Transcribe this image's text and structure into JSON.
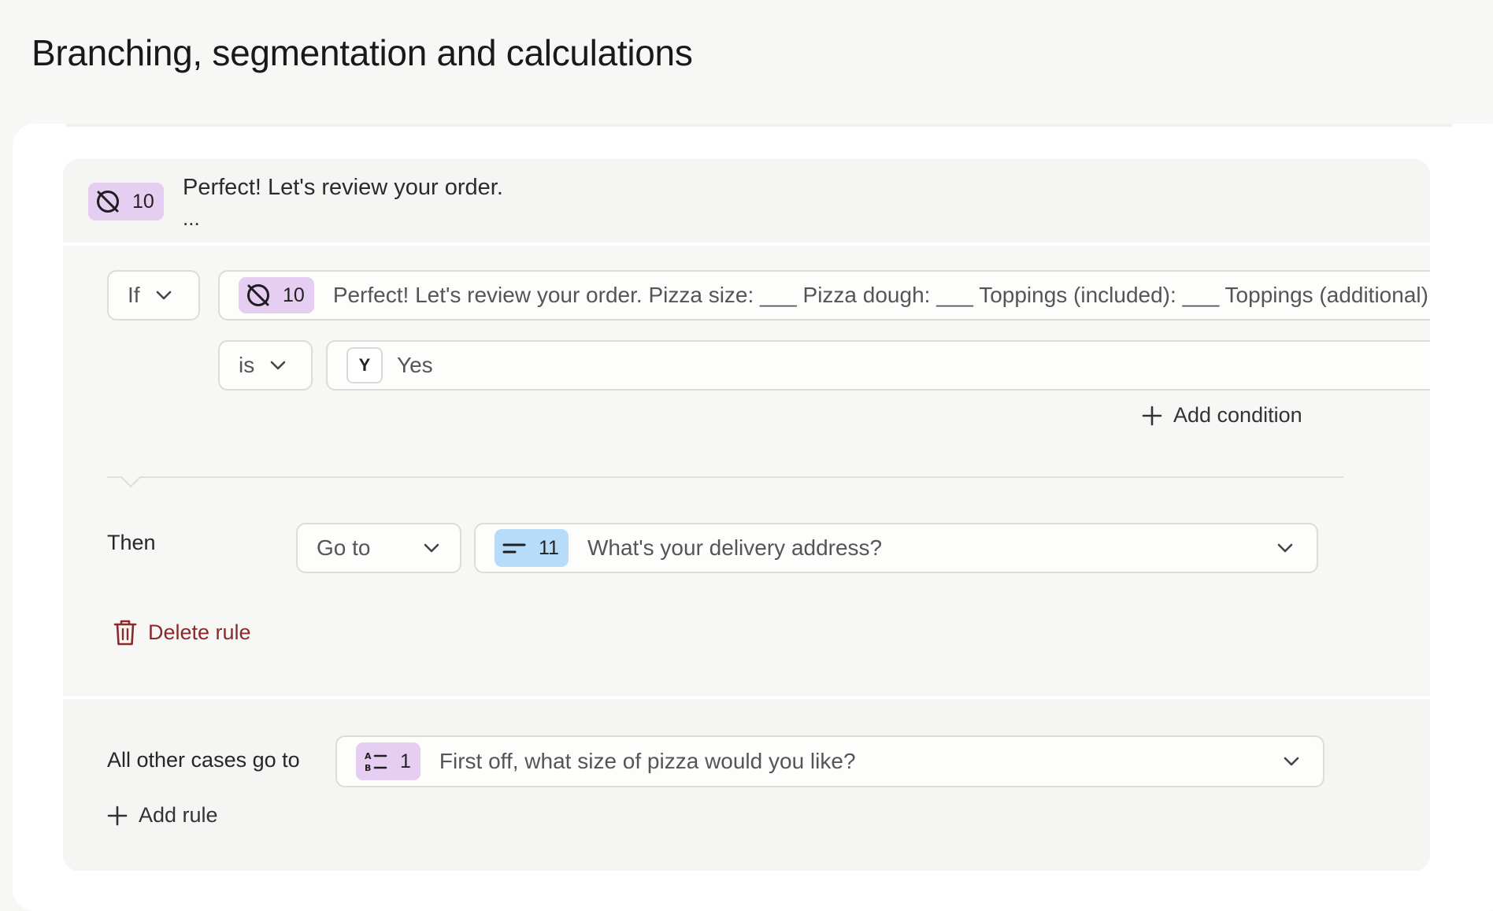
{
  "page": {
    "title": "Branching, segmentation and calculations"
  },
  "header": {
    "question_number": "10",
    "question_title": "Perfect! Let's review your order.",
    "ellipsis": "..."
  },
  "rule": {
    "if_label": "If",
    "condition": {
      "question_number": "10",
      "question_text": "Perfect! Let's review your order. Pizza size: ___ Pizza dough: ___ Toppings (included): ___ Toppings (additional):"
    },
    "operator": "is",
    "value": {
      "key": "Y",
      "label": "Yes"
    },
    "add_condition_label": "Add condition",
    "then_label": "Then",
    "action": "Go to",
    "destination": {
      "question_number": "11",
      "question_text": "What's your delivery address?"
    },
    "delete_label": "Delete rule"
  },
  "fallback": {
    "label": "All other cases go to",
    "destination": {
      "question_number": "1",
      "question_text": "First off, what size of pizza would you like?"
    },
    "add_rule_label": "Add rule"
  },
  "colors": {
    "badge_statement": "#e6cdf2",
    "badge_short_text": "#b6dcfa",
    "danger": "#8b2a2a"
  },
  "icons": {
    "statement": "statement-icon",
    "short_text": "short-text-icon",
    "multiple_choice": "multiple-choice-icon"
  }
}
